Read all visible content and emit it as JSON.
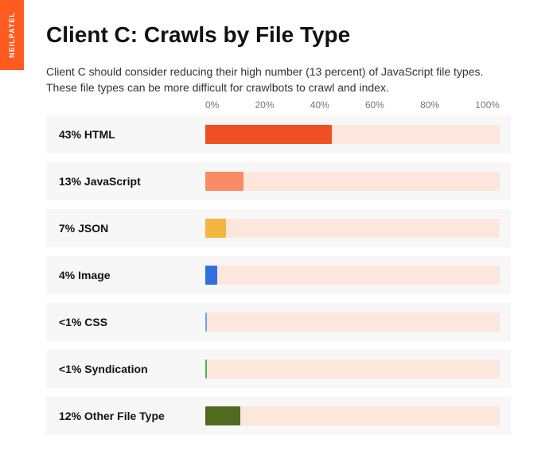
{
  "brand_tab": "NEILPATEL",
  "title": "Client C: Crawls by File Type",
  "description": "Client C should consider reducing their high number (13 percent) of JavaScript file types. These file types can be more difficult for crawlbots to crawl and index.",
  "axis_ticks": [
    "0%",
    "20%",
    "40%",
    "60%",
    "80%",
    "100%"
  ],
  "chart_data": {
    "type": "bar",
    "title": "Client C: Crawls by File Type",
    "xlabel": "",
    "ylabel": "",
    "xlim": [
      0,
      100
    ],
    "categories": [
      "HTML",
      "JavaScript",
      "JSON",
      "Image",
      "CSS",
      "Syndication",
      "Other File Type"
    ],
    "display_labels": [
      "43% HTML",
      "13% JavaScript",
      "7% JSON",
      "4% Image",
      "<1% CSS",
      "<1% Syndication",
      "12% Other File Type"
    ],
    "values": [
      43,
      13,
      7,
      4,
      0.5,
      0.5,
      12
    ],
    "colors": [
      "#f04e23",
      "#f98b66",
      "#f4b63f",
      "#2f6fe0",
      "#6aa6f0",
      "#4caf50",
      "#4f6b1f"
    ],
    "track_color": "#fde6dc"
  }
}
